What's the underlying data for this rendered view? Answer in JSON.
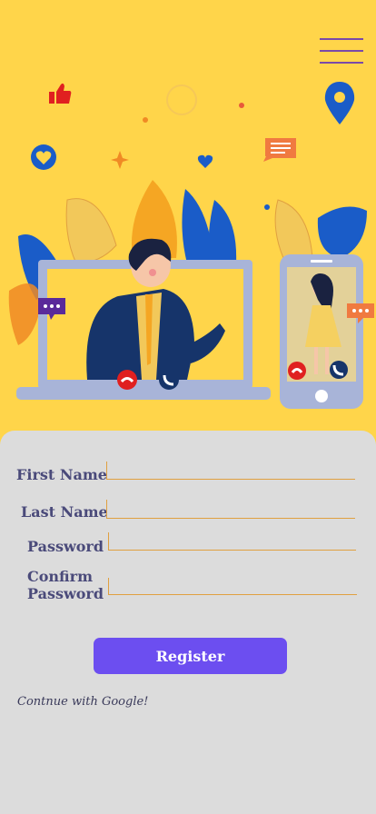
{
  "form": {
    "first_name_label": "First Name",
    "last_name_label": "Last Name",
    "password_label": "Password",
    "confirm_password_label": "Confirm\nPassword",
    "first_name_value": "",
    "last_name_value": "",
    "password_value": "",
    "confirm_password_value": ""
  },
  "actions": {
    "register_label": "Register",
    "google_label": "Contnue with Google!"
  },
  "icons": {
    "menu": "hamburger-menu-icon",
    "location": "location-pin-icon",
    "thumbs_up": "thumbs-up-icon",
    "heart": "heart-icon",
    "chat": "chat-bubble-icon",
    "call_decline": "phone-decline-icon",
    "call_accept": "phone-accept-icon"
  },
  "colors": {
    "background": "#ffd54a",
    "sheet": "#dcdcdc",
    "accent": "#6c4ef0",
    "field_line": "#e0a040",
    "label": "#4a4a7a"
  }
}
